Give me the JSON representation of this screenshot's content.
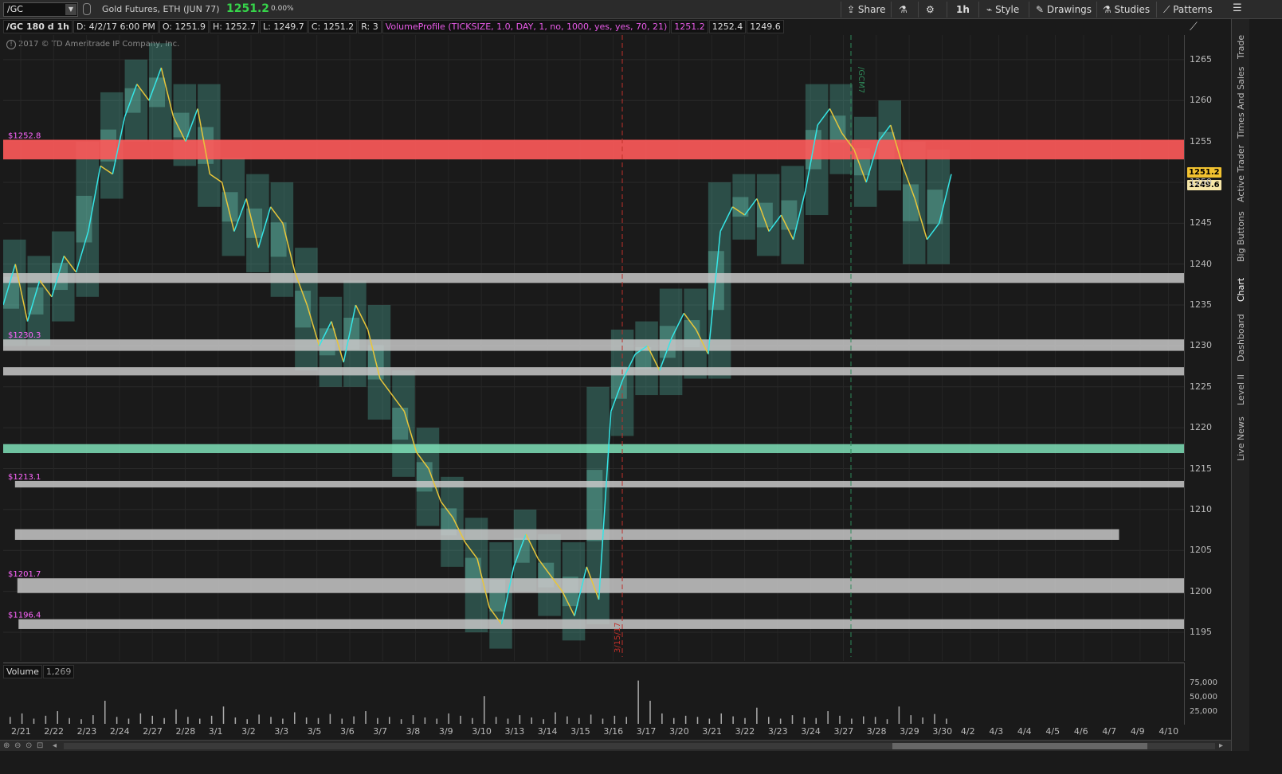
{
  "topbar": {
    "symbol": "/GC",
    "description": "Gold Futures, ETH (JUN 77)",
    "last_price": "1251.2",
    "change_pct": "0.00%",
    "share_label": "Share",
    "timeframe_label": "1h",
    "style_label": "Style",
    "drawings_label": "Drawings",
    "studies_label": "Studies",
    "patterns_label": "Patterns"
  },
  "infobar": {
    "chart_id": "/GC 180 d 1h",
    "date": "D: 4/2/17 6:00 PM",
    "open": "O: 1251.9",
    "high": "H: 1252.7",
    "low": "L: 1249.7",
    "close": "C: 1251.2",
    "range": "R: 3",
    "study": "VolumeProfile (TICKSIZE, 1.0, DAY, 1, no, 1000, yes, yes, 70, 21)",
    "study_v1": "1251.2",
    "study_v2": "1252.4",
    "study_v3": "1249.6"
  },
  "copyright": "2017 © TD Ameritrade IP Company, Inc.",
  "price_axis": {
    "ticks": [
      "1265",
      "1260",
      "1255",
      "1250",
      "1245",
      "1240",
      "1235",
      "1230",
      "1225",
      "1220",
      "1215",
      "1210",
      "1205",
      "1200",
      "1195"
    ],
    "ymin": 1191.5,
    "ymax": 1268,
    "tag_last": "1251.2",
    "tag_low": "1249.6"
  },
  "levels": [
    {
      "label": "$1252.8",
      "price_lo": 1252.8,
      "price_hi": 1255.2,
      "color": "#ff5a5a",
      "x_start": 0,
      "x_end": 1
    },
    {
      "label": "",
      "price_lo": 1237.7,
      "price_hi": 1238.9,
      "color": "#c8c8c8",
      "x_start": 0,
      "x_end": 1
    },
    {
      "label": "$1230.3",
      "price_lo": 1229.4,
      "price_hi": 1230.8,
      "color": "#c8c8c8",
      "x_start": 0,
      "x_end": 1
    },
    {
      "label": "",
      "price_lo": 1226.4,
      "price_hi": 1227.4,
      "color": "#c8c8c8",
      "x_start": 0,
      "x_end": 1
    },
    {
      "label": "",
      "price_lo": 1216.9,
      "price_hi": 1218.0,
      "color": "#7fe0b8",
      "x_start": 0,
      "x_end": 1
    },
    {
      "label": "$1213.1",
      "price_lo": 1212.7,
      "price_hi": 1213.5,
      "color": "#c8c8c8",
      "x_start": 0.01,
      "x_end": 1
    },
    {
      "label": "",
      "price_lo": 1206.3,
      "price_hi": 1207.6,
      "color": "#c8c8c8",
      "x_start": 0.01,
      "x_end": 0.945
    },
    {
      "label": "$1201.7",
      "price_lo": 1199.8,
      "price_hi": 1201.6,
      "color": "#c8c8c8",
      "x_start": 0.012,
      "x_end": 1
    },
    {
      "label": "$1196.4",
      "price_lo": 1195.4,
      "price_hi": 1196.6,
      "color": "#c8c8c8",
      "x_start": 0.013,
      "x_end": 1
    }
  ],
  "markers": {
    "red_line_label": "3/15/17",
    "green_line_label": "/GCM7"
  },
  "chart_data": {
    "type": "line",
    "title": "",
    "xlabel": "",
    "ylabel": "",
    "ylim": [
      1191.5,
      1268
    ],
    "series": [
      {
        "values": [
          1235,
          1240,
          1233,
          1238,
          1236,
          1241,
          1239,
          1244,
          1252,
          1251,
          1258,
          1262,
          1260,
          1264,
          1258,
          1255,
          1259,
          1251,
          1250,
          1244,
          1248,
          1242,
          1247,
          1245,
          1239,
          1235,
          1230,
          1233,
          1228,
          1235,
          1232,
          1226,
          1224,
          1222,
          1217,
          1215,
          1211,
          1209,
          1206,
          1204,
          1198,
          1196,
          1203,
          1207,
          1204,
          1202,
          1200,
          1197,
          1203,
          1199,
          1222,
          1226,
          1229,
          1230,
          1227,
          1231,
          1234,
          1232,
          1229,
          1244,
          1247,
          1246,
          1248,
          1244,
          1246,
          1243,
          1249,
          1257,
          1259,
          1256,
          1254,
          1250,
          1255,
          1257,
          1252,
          1248,
          1243,
          1245,
          1251
        ]
      }
    ]
  },
  "volume": {
    "label": "Volume",
    "value": "1,269",
    "axis_ticks": [
      "75,000",
      "50,000",
      "25,000"
    ],
    "bars": [
      12,
      18,
      9,
      14,
      22,
      10,
      8,
      15,
      40,
      12,
      9,
      18,
      14,
      10,
      25,
      12,
      9,
      14,
      30,
      11,
      8,
      16,
      12,
      9,
      20,
      11,
      10,
      17,
      9,
      13,
      22,
      10,
      12,
      8,
      15,
      11,
      9,
      18,
      14,
      10,
      48,
      12,
      9,
      15,
      11,
      8,
      20,
      13,
      10,
      16,
      9,
      14,
      12,
      75,
      40,
      18,
      10,
      14,
      12,
      9,
      18,
      13,
      10,
      28,
      12,
      9,
      15,
      11,
      10,
      22,
      14,
      9,
      13,
      12,
      8,
      30,
      15,
      11,
      17,
      9
    ]
  },
  "dates": [
    "2/21",
    "2/22",
    "2/23",
    "2/24",
    "2/27",
    "2/28",
    "3/1",
    "3/2",
    "3/3",
    "3/5",
    "3/6",
    "3/7",
    "3/8",
    "3/9",
    "3/10",
    "3/13",
    "3/14",
    "3/15",
    "3/16",
    "3/17",
    "3/20",
    "3/21",
    "3/22",
    "3/23",
    "3/24",
    "3/27",
    "3/28",
    "3/29",
    "3/30",
    "4/2",
    "4/3",
    "4/4",
    "4/5",
    "4/6",
    "4/7",
    "4/9",
    "4/10"
  ],
  "sidebar": [
    "Trade",
    "Times And Sales",
    "Active Trader",
    "Big Buttons",
    "Chart",
    "Dashboard",
    "Level II",
    "Live News"
  ]
}
